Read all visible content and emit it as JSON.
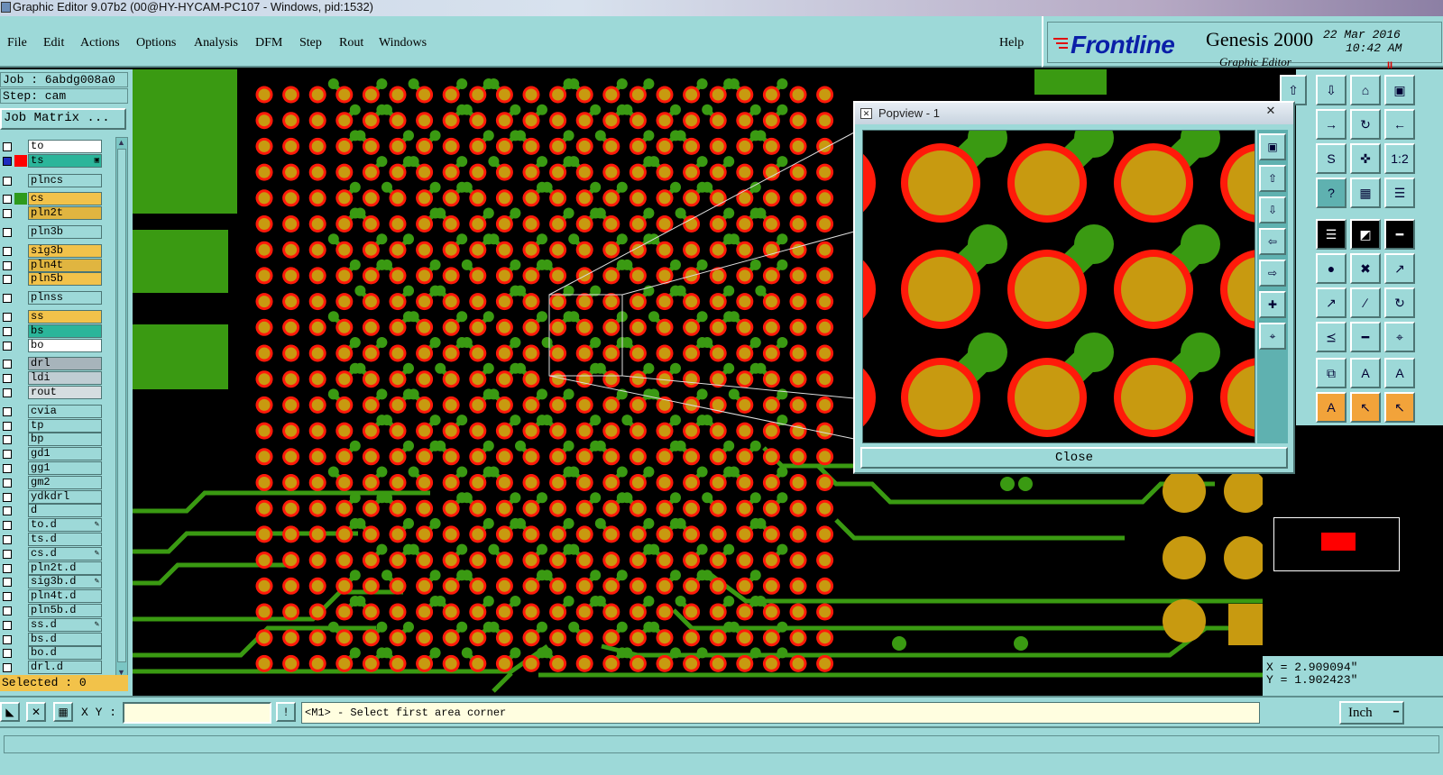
{
  "window": {
    "title": "Graphic Editor 9.07b2 (00@HY-HYCAM-PC107 - Windows, pid:1532)"
  },
  "menu": {
    "items": [
      "File",
      "Edit",
      "Actions",
      "Options",
      "Analysis",
      "DFM",
      "Step",
      "Rout",
      "Windows"
    ],
    "help": "Help"
  },
  "brand": {
    "logo": "Frontline",
    "product": "Genesis 2000",
    "subtitle": "Graphic Editor",
    "date": "22 Mar 2016",
    "time": "10:42 AM",
    "pause_glyph": "II"
  },
  "left": {
    "job": "Job : 6abdg008a0",
    "step": "Step: cam",
    "job_matrix": "Job Matrix ...",
    "selected": "Selected : 0",
    "layers": [
      {
        "name": "to",
        "bg": "#ffffff",
        "color": "",
        "flag": ""
      },
      {
        "name": "ts",
        "bg": "#2bb59a",
        "color": "#ff0000",
        "flag": "▣",
        "cb_blue": true
      },
      {
        "name": "plncs",
        "bg": "#9dd9d8",
        "color": "",
        "flag": ""
      },
      {
        "name": "cs",
        "bg": "#f2c24a",
        "color": "#2e9a1c",
        "flag": ""
      },
      {
        "name": "pln2t",
        "bg": "#e0b540",
        "color": "",
        "flag": ""
      },
      {
        "name": "pln3b",
        "bg": "#9dd9d8",
        "color": "",
        "flag": ""
      },
      {
        "name": "sig3b",
        "bg": "#f2c24a",
        "color": "",
        "flag": ""
      },
      {
        "name": "pln4t",
        "bg": "#e0b540",
        "color": "",
        "flag": ""
      },
      {
        "name": "pln5b",
        "bg": "#f2c24a",
        "color": "",
        "flag": ""
      },
      {
        "name": "plnss",
        "bg": "#9dd9d8",
        "color": "",
        "flag": ""
      },
      {
        "name": "ss",
        "bg": "#f2c24a",
        "color": "",
        "flag": ""
      },
      {
        "name": "bs",
        "bg": "#2bb59a",
        "color": "",
        "flag": ""
      },
      {
        "name": "bo",
        "bg": "#ffffff",
        "color": "",
        "flag": ""
      },
      {
        "name": "drl",
        "bg": "#a7b4bb",
        "color": "",
        "flag": ""
      },
      {
        "name": "ldi",
        "bg": "#c0cdd3",
        "color": "",
        "flag": ""
      },
      {
        "name": "rout",
        "bg": "#d6dde0",
        "color": "",
        "flag": ""
      },
      {
        "name": "cvia",
        "bg": "#9dd9d8",
        "color": "",
        "flag": ""
      },
      {
        "name": "tp",
        "bg": "#9dd9d8",
        "color": "",
        "flag": ""
      },
      {
        "name": "bp",
        "bg": "#9dd9d8",
        "color": "",
        "flag": ""
      },
      {
        "name": "gd1",
        "bg": "#9dd9d8",
        "color": "",
        "flag": ""
      },
      {
        "name": "gg1",
        "bg": "#9dd9d8",
        "color": "",
        "flag": ""
      },
      {
        "name": "gm2",
        "bg": "#9dd9d8",
        "color": "",
        "flag": ""
      },
      {
        "name": "ydkdrl",
        "bg": "#9dd9d8",
        "color": "",
        "flag": ""
      },
      {
        "name": "d",
        "bg": "#9dd9d8",
        "color": "",
        "flag": ""
      },
      {
        "name": "to.d",
        "bg": "#9dd9d8",
        "color": "",
        "flag": "✎"
      },
      {
        "name": "ts.d",
        "bg": "#9dd9d8",
        "color": "",
        "flag": ""
      },
      {
        "name": "cs.d",
        "bg": "#9dd9d8",
        "color": "",
        "flag": "✎"
      },
      {
        "name": "pln2t.d",
        "bg": "#9dd9d8",
        "color": "",
        "flag": ""
      },
      {
        "name": "sig3b.d",
        "bg": "#9dd9d8",
        "color": "",
        "flag": "✎"
      },
      {
        "name": "pln4t.d",
        "bg": "#9dd9d8",
        "color": "",
        "flag": ""
      },
      {
        "name": "pln5b.d",
        "bg": "#9dd9d8",
        "color": "",
        "flag": ""
      },
      {
        "name": "ss.d",
        "bg": "#9dd9d8",
        "color": "",
        "flag": "✎"
      },
      {
        "name": "bs.d",
        "bg": "#9dd9d8",
        "color": "",
        "flag": ""
      },
      {
        "name": "bo.d",
        "bg": "#9dd9d8",
        "color": "",
        "flag": ""
      },
      {
        "name": "drl.d",
        "bg": "#9dd9d8",
        "color": "",
        "flag": ""
      }
    ]
  },
  "tools": {
    "icons": [
      "up-view-icon",
      "save-view-icon",
      "home-icon",
      "window-icon",
      "zoom-in-icon",
      "zoom-back-icon",
      "zoom-out-icon",
      "redraw-icon",
      "pan-icon",
      "one-to-one-icon",
      "help-icon",
      "grid-icon",
      "layer-a-icon",
      "layer-b-icon",
      "measure-icon",
      "ruler-icon",
      "circle-icon",
      "cross-icon",
      "snap-icon",
      "snap-2-icon",
      "line-icon",
      "arc-icon",
      "bracket-icon",
      "minus-icon",
      "center-icon",
      "copy-icon",
      "text-a-icon",
      "text-b-icon",
      "text-c-icon",
      "pointer-icon",
      "select-icon",
      "net-icon"
    ],
    "labels": [
      "⇧",
      "⇩",
      "⌂",
      "▣",
      "→",
      "↻",
      "←",
      "S",
      "✜",
      "1:2",
      "?",
      "▦",
      "☰",
      "☰",
      "◩",
      "━",
      "●",
      "✖",
      "↗",
      "↗",
      "∕",
      "↻",
      "⪯",
      "━",
      "⌖",
      "⧉",
      "A",
      "A",
      "A",
      "↖",
      "↖",
      "↘"
    ]
  },
  "popview": {
    "title": "Popview - 1",
    "close": "Close",
    "close_x": "✕",
    "icon_glyph": "✕",
    "tool_icons": [
      "fit-icon",
      "up-icon",
      "down-icon",
      "left-icon",
      "right-icon",
      "shrink-icon",
      "center-icon"
    ],
    "tool_labels": [
      "▣",
      "⇧",
      "⇩",
      "⇦",
      "⇨",
      "✚",
      "⌖"
    ]
  },
  "coords": {
    "x": "X = 2.909094\"",
    "y": "Y = 1.902423\""
  },
  "status": {
    "xy_label": "X Y :",
    "xy_value": "",
    "prompt": "<M1> - Select first area corner",
    "units": "Inch",
    "dropdown_glyph": "━",
    "bang": "!",
    "btn1": "◣",
    "btn2": "✕",
    "btn3": "▦"
  },
  "colors": {
    "ui": "#9dd9d8",
    "trace": "#3a9a12",
    "pad_ring": "#ff1a0a",
    "pad_fill": "#c89a10",
    "selected_bg": "#f2c24a"
  }
}
